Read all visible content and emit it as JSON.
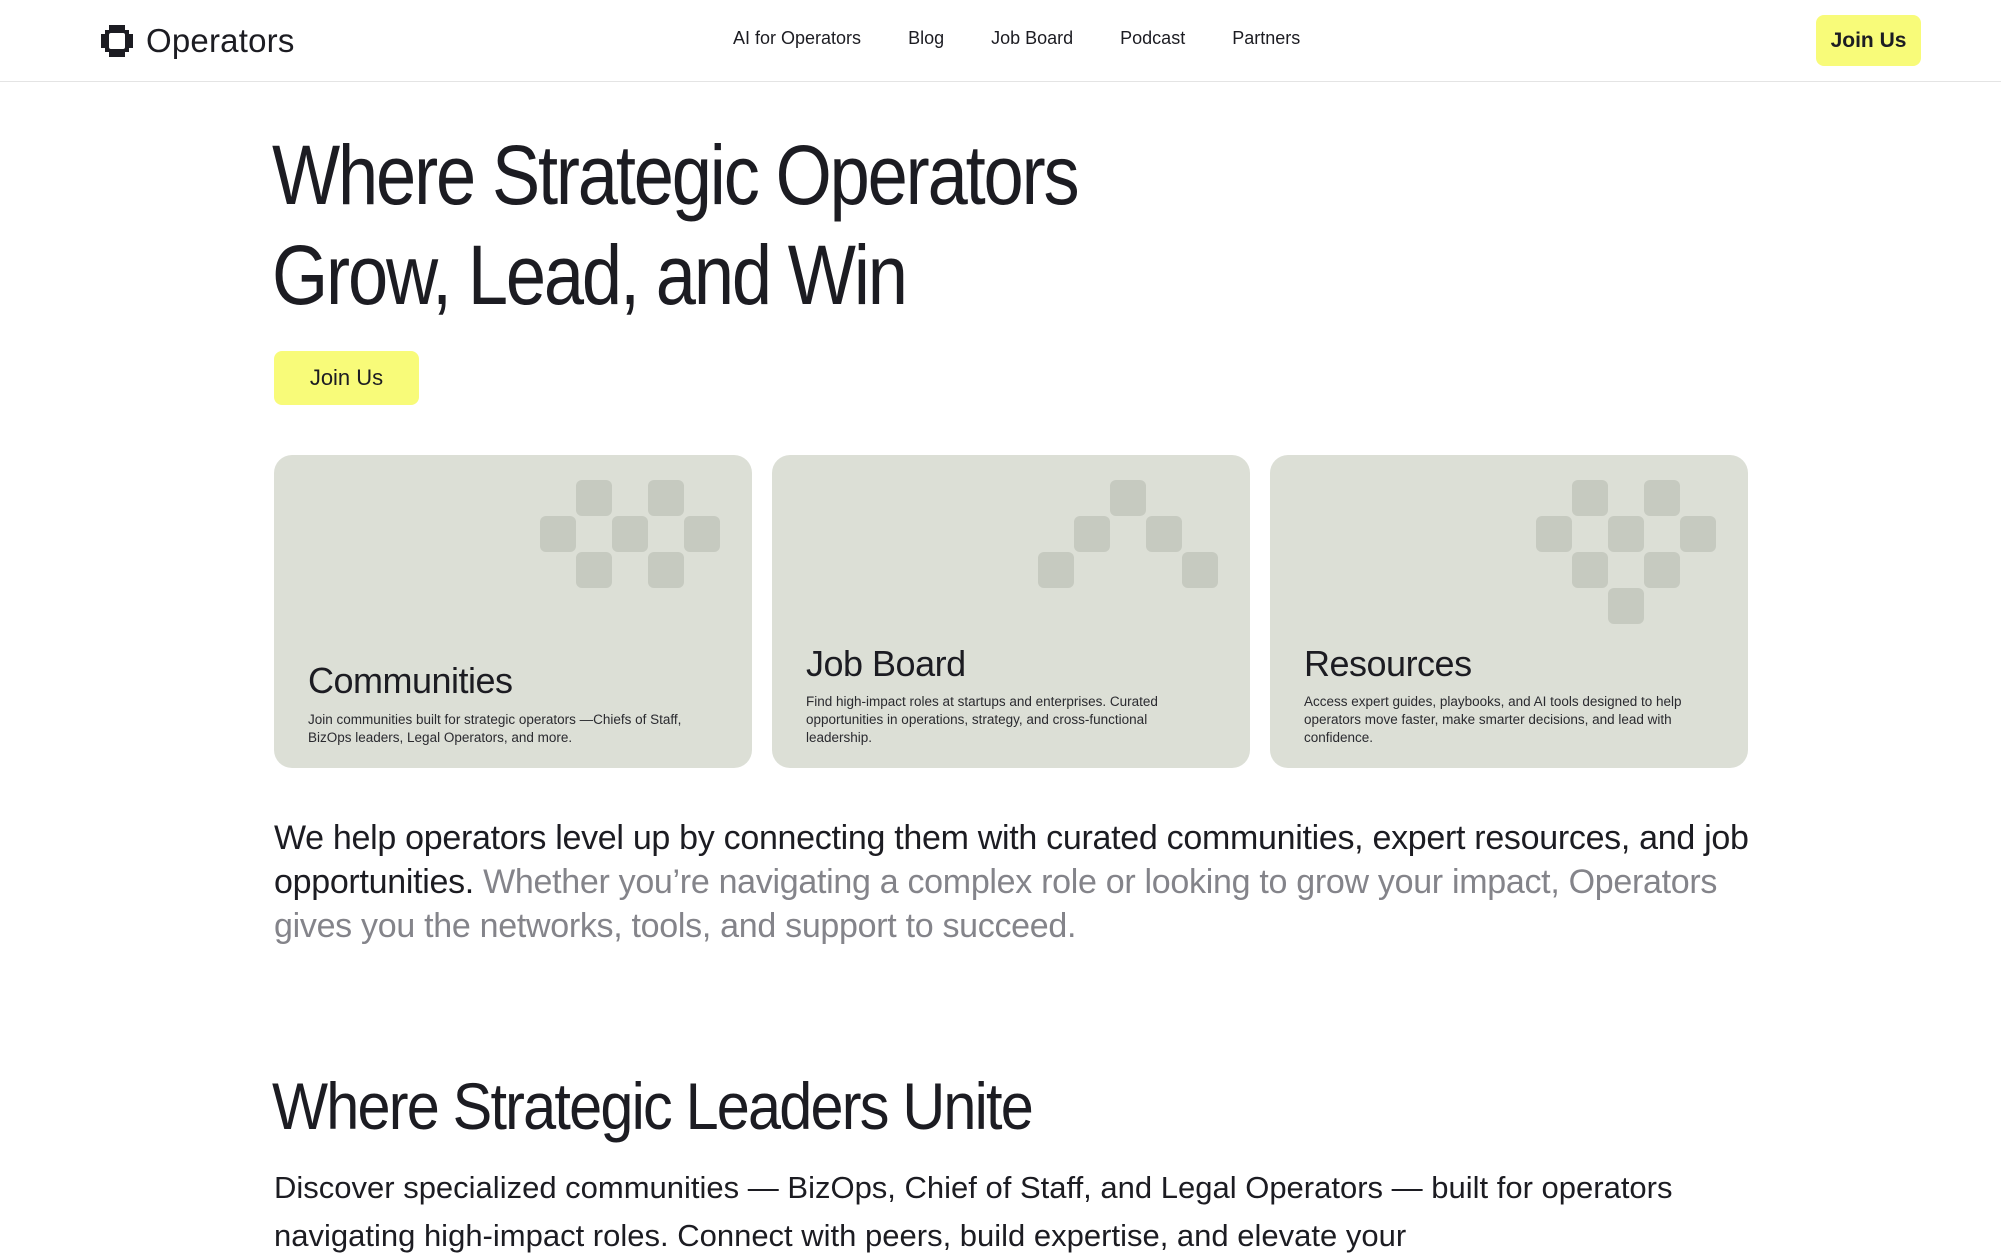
{
  "header": {
    "logo_text": "Operators",
    "nav": [
      "AI for Operators",
      "Blog",
      "Job Board",
      "Podcast",
      "Partners"
    ],
    "join_label": "Join Us"
  },
  "hero": {
    "title_line1": "Where Strategic Operators",
    "title_line2": "Grow, Lead, and Win",
    "join_label": "Join Us"
  },
  "cards": [
    {
      "title": "Communities",
      "description": "Join  communities built for strategic operators —Chiefs of Staff, BizOps leaders, Legal Operators, and more."
    },
    {
      "title": "Job Board",
      "description": "Find high-impact roles at startups and enterprises. Curated opportunities in operations, strategy, and cross-functional leadership."
    },
    {
      "title": "Resources",
      "description": "Access expert guides, playbooks, and AI tools designed to help operators move faster, make smarter decisions, and lead with confidence."
    }
  ],
  "intro": {
    "primary": "We help operators level up by connecting them with curated communities, expert resources, and job opportunities.",
    "secondary": " Whether you’re navigating a complex role or looking to grow your impact, Operators gives you the networks, tools, and support to succeed."
  },
  "section": {
    "title": "Where Strategic Leaders Unite",
    "description": "Discover specialized communities — BizOps, Chief of Staff, and Legal Operators — built for operators navigating high-impact roles. Connect with peers, build expertise, and elevate your"
  },
  "colors": {
    "accent": "#f8fb79",
    "card_bg": "#dcdfd6",
    "pattern": "#c6cac0",
    "text": "#1c1c22",
    "muted_text": "#84848a"
  }
}
